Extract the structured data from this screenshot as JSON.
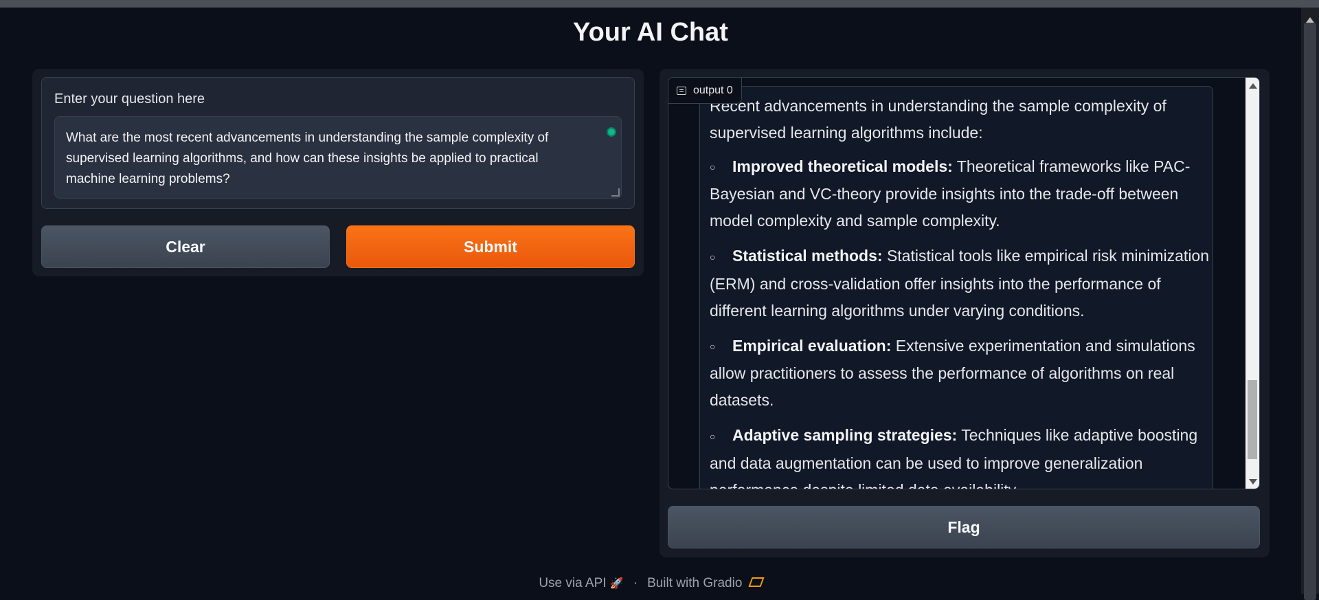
{
  "app": {
    "title": "Your AI Chat"
  },
  "input": {
    "label": "Enter your question here",
    "value": "What are the most recent advancements in understanding the sample complexity of supervised learning algorithms, and how can these insights be applied to practical machine learning problems?"
  },
  "buttons": {
    "clear": "Clear",
    "submit": "Submit",
    "flag": "Flag"
  },
  "output": {
    "tag": "output 0",
    "intro": "Recent advancements in understanding the sample complexity of supervised learning algorithms include:",
    "items": [
      {
        "title": "Improved theoretical models:",
        "text": "Theoretical frameworks like PAC-Bayesian and VC-theory provide insights into the trade-off between model complexity and sample complexity."
      },
      {
        "title": "Statistical methods:",
        "text": "Statistical tools like empirical risk minimization (ERM) and cross-validation offer insights into the performance of different learning algorithms under varying conditions."
      },
      {
        "title": "Empirical evaluation:",
        "text": "Extensive experimentation and simulations allow practitioners to assess the performance of algorithms on real datasets."
      },
      {
        "title": "Adaptive sampling strategies:",
        "text": "Techniques like adaptive boosting and data augmentation can be used to improve generalization performance despite limited data availability."
      }
    ],
    "bullet_marker": "○"
  },
  "footer": {
    "api": "Use via API",
    "separator": "·",
    "built": "Built with Gradio"
  },
  "colors": {
    "accent": "#f97316",
    "background": "#0b0f19",
    "panel": "#161b26"
  }
}
